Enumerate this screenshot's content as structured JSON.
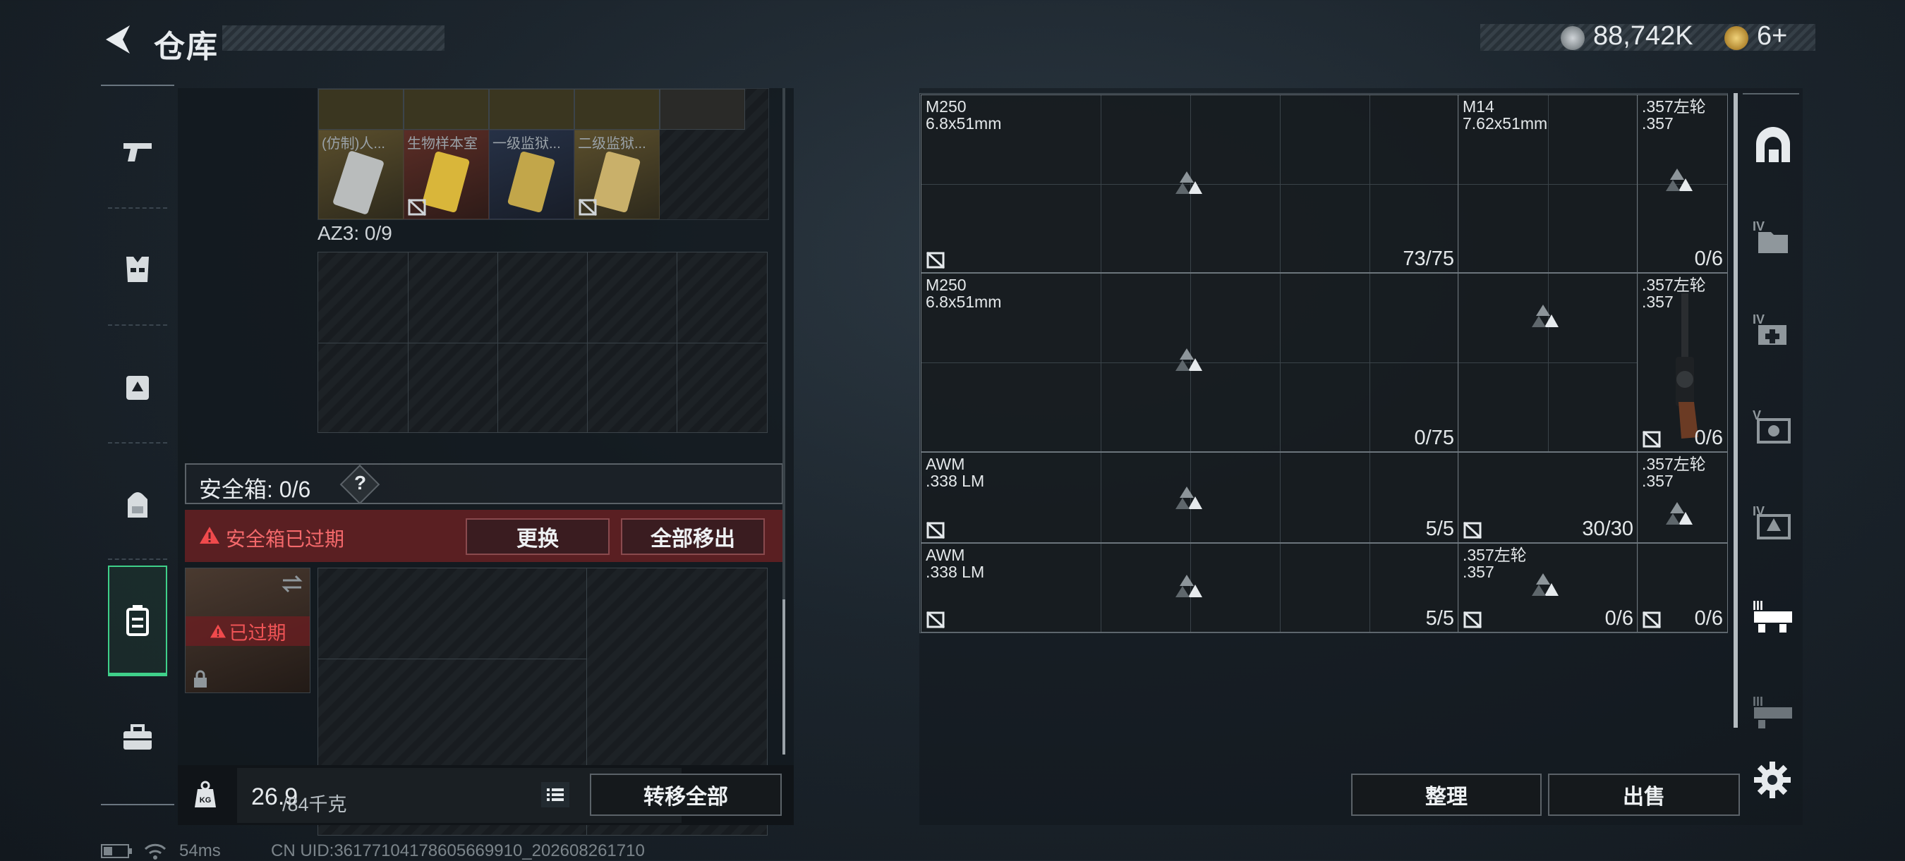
{
  "header": {
    "title": "仓库",
    "currency_amount": "88,742K",
    "ticket_count": "6+"
  },
  "sidenav": {
    "items": [
      "weapon-tab",
      "armor-tab",
      "chest-rig-tab",
      "backpack-tab",
      "safe-case-tab",
      "toolbox-tab"
    ],
    "active": "safe-case-tab"
  },
  "container": {
    "item_labels": [
      "(仿制)人...",
      "生物样本室",
      "一级监狱...",
      "二级监狱..."
    ],
    "az3_label": "AZ3: 0/9",
    "safebox_label": "安全箱: 0/6",
    "help_icon": "?",
    "expired_warning": "安全箱已过期",
    "replace_button": "更换",
    "move_all_out_button": "全部移出",
    "expired_badge": "已过期",
    "weight_current": "26.9",
    "weight_capacity": "/84千克",
    "transfer_all_button": "转移全部"
  },
  "stash": {
    "ammo": [
      {
        "name": "M250\n6.8x51mm",
        "count": "73/75"
      },
      {
        "name": "M14\n7.62x51mm",
        "count": ""
      },
      {
        "name": ".357左轮\n.357",
        "count": "0/6"
      },
      {
        "name": "M250\n6.8x51mm",
        "count": "0/75"
      },
      {
        "name": ".357左轮\n.357",
        "count": "0/6"
      },
      {
        "name": "AWM\n.338 LM",
        "count": "5/5"
      },
      {
        "name": "",
        "count": "30/30"
      },
      {
        "name": ".357左轮\n.357",
        "count": ""
      },
      {
        "name": "AWM\n.338 LM",
        "count": "5/5"
      },
      {
        "name": ".357左轮\n.357",
        "count": "0/6"
      },
      {
        "name": "",
        "count": "0/6"
      }
    ],
    "sort_button": "整理",
    "sell_button": "出售"
  },
  "footer": {
    "ping": "54ms",
    "uid": "CN UID:36177104178605669910_202608261710"
  },
  "colors": {
    "accent_green": "#3fd08a",
    "warning_red": "#e0393c",
    "panel_bg": "#12181d"
  }
}
